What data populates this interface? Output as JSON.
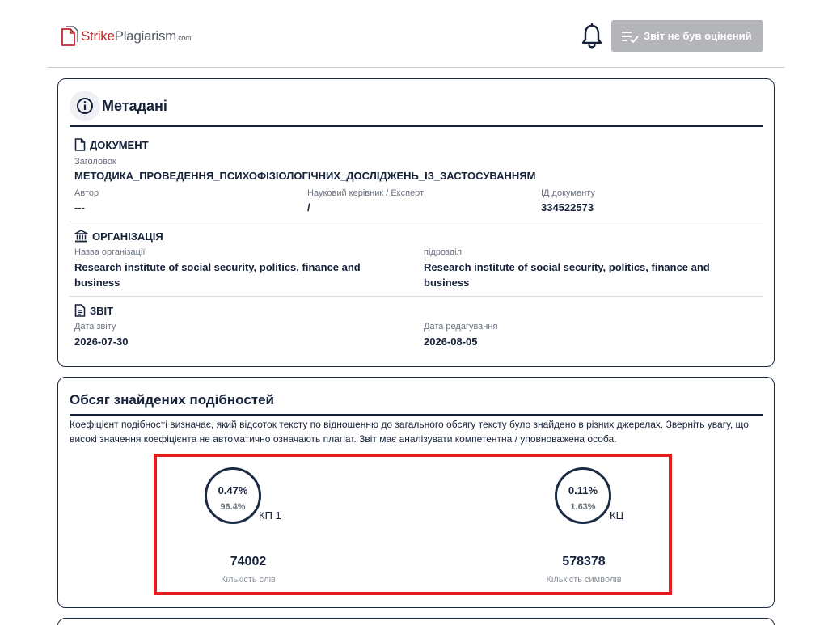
{
  "header": {
    "logo": {
      "strike": "Strike",
      "plagiarism": "Plagiarism",
      "com": ".com"
    },
    "status_button_label": "Звіт не був оцінений"
  },
  "metadata": {
    "title": "Метадані",
    "document": {
      "heading": "ДОКУМЕНТ",
      "title_label": "Заголовок",
      "title_value": "МЕТОДИКА_ПРОВЕДЕННЯ_ПСИХОФІЗІОЛОГІЧНИХ_ДОСЛІДЖЕНЬ_ІЗ_ЗАСТОСУВАННЯМ",
      "author_label": "Автор",
      "author_value": "---",
      "supervisor_label": "Науковий керівник / Експерт",
      "supervisor_value": "/",
      "doc_id_label": "ІД документу",
      "doc_id_value": "334522573"
    },
    "organization": {
      "heading": "ОРГАНІЗАЦІЯ",
      "name_label": "Назва організації",
      "name_value": "Research institute of social security, politics, finance and business",
      "unit_label": "підрозділ",
      "unit_value": "Research institute of social security, politics, finance and business"
    },
    "report": {
      "heading": "ЗВІТ",
      "date_label": "Дата звіту",
      "date_value": "2026-07-30",
      "edit_label": "Дата редагування",
      "edit_value": "2026-08-05"
    }
  },
  "similarity": {
    "title": "Обсяг знайдених подібностей",
    "description": "Коефіцієнт подібності визначає, який відсоток тексту по відношенню до загального обсягу тексту було знайдено в різних джерелах. Зверніть увагу, що високі значення коефіцієнта не автоматично означають плагіат. Звіт має аналізувати компетентна / уповноважена особа.",
    "gauges": [
      {
        "percent": "0.47%",
        "secondary": "96.4%",
        "label": "КП 1"
      },
      {
        "percent": "0.11%",
        "secondary": "1.63%",
        "label": "КЦ"
      }
    ],
    "counts": [
      {
        "value": "74002",
        "label": "Кількість слів"
      },
      {
        "value": "578378",
        "label": "Кількість символів"
      }
    ]
  },
  "colors": {
    "brand_red": "#c0272d",
    "navy": "#16213a",
    "highlight_red": "#e41e1e",
    "button_gray": "#b3b5b9"
  }
}
